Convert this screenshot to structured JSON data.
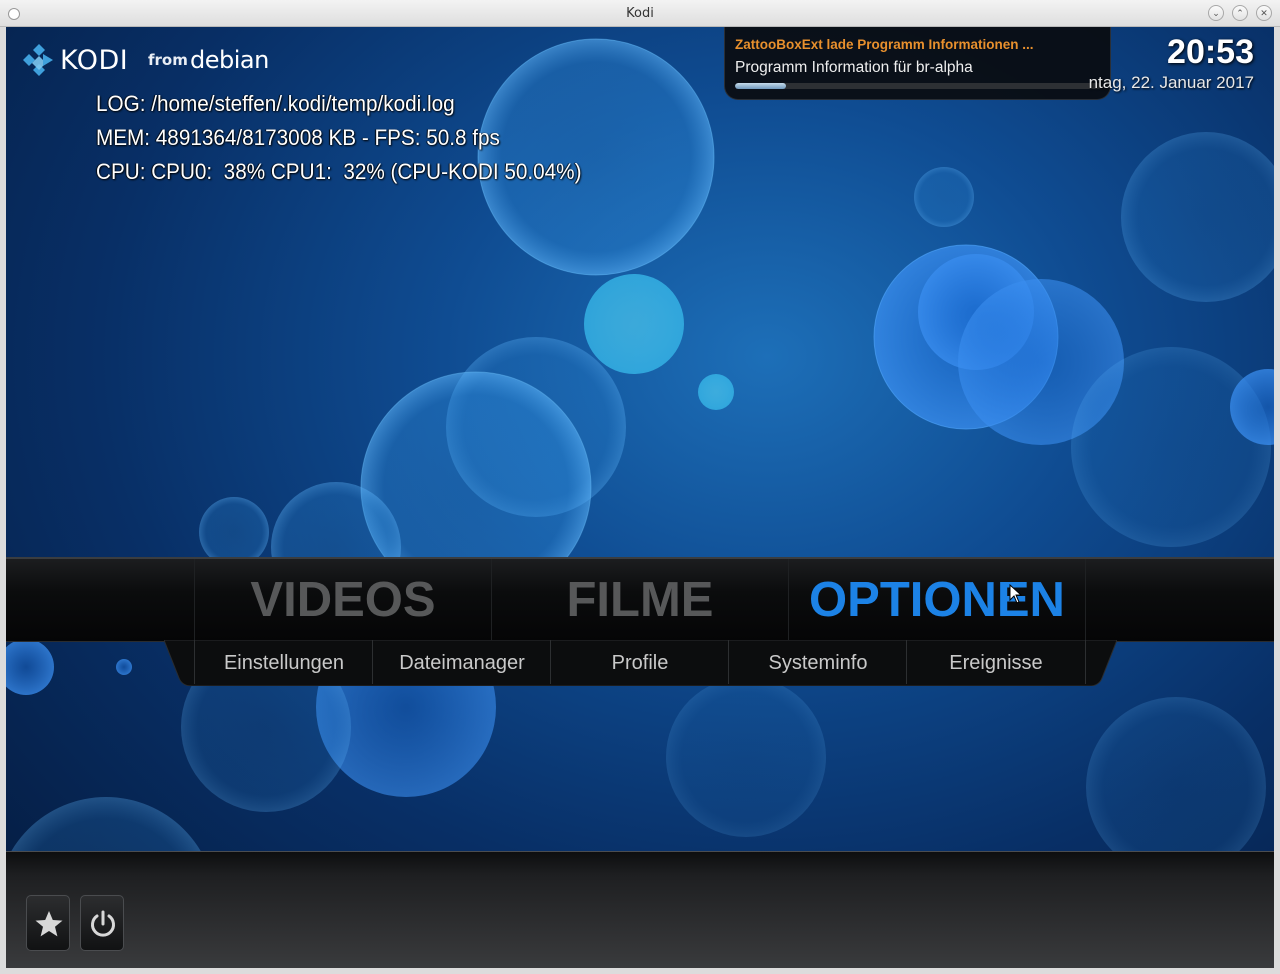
{
  "window": {
    "title": "Kodi",
    "buttons": [
      "minimize-icon",
      "maximize-icon",
      "close-icon"
    ]
  },
  "header": {
    "logo_kodi": "KODI",
    "logo_from": "from",
    "logo_debian": "debian",
    "time": "20:53",
    "date": "ntag, 22. Januar 2017"
  },
  "debug_overlay": {
    "log": "LOG: /home/steffen/.kodi/temp/kodi.log",
    "mem": "MEM: 4891364/8173008 KB - FPS: 50.8 fps",
    "cpu": "CPU: CPU0:  38% CPU1:  32% (CPU-KODI 50.04%)"
  },
  "notification": {
    "heading": "ZattooBoxExt lade Programm Informationen ...",
    "message": "Programm Information für br-alpha",
    "progress": 0.14,
    "heading_color": "#e8902d"
  },
  "main_menu": {
    "items": [
      {
        "label": "VIDEOS",
        "active": false
      },
      {
        "label": "FILME",
        "active": false
      },
      {
        "label": "OPTIONEN",
        "active": true
      }
    ],
    "active_color": "#1c82e6"
  },
  "sub_menu": {
    "items": [
      "Einstellungen",
      "Dateimanager",
      "Profile",
      "Systeminfo",
      "Ereignisse"
    ]
  },
  "bottom_bar": {
    "buttons": [
      {
        "icon": "star-icon"
      },
      {
        "icon": "power-icon"
      }
    ]
  }
}
